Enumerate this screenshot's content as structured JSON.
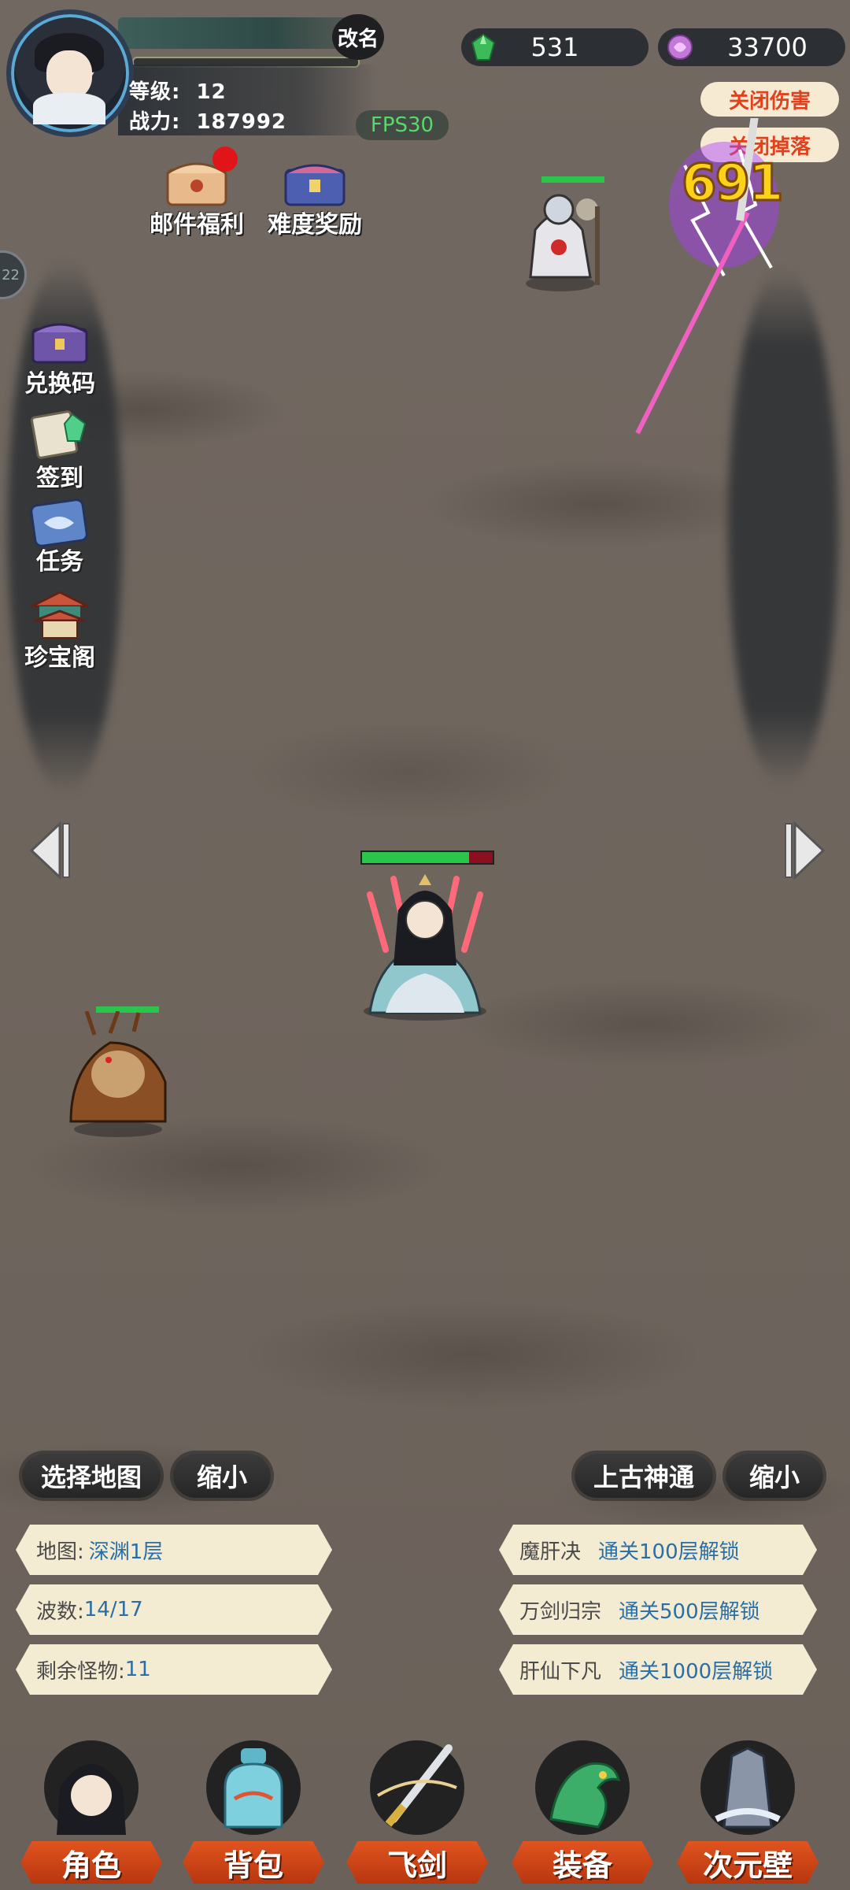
{
  "player": {
    "rename_label": "改名",
    "level_label": "等级:",
    "level": "12",
    "power_label": "战力:",
    "power": "187992",
    "fps": "FPS30"
  },
  "currency": {
    "gems": "531",
    "spirit": "33700",
    "gem_color": "#3dbb5a",
    "spirit_color": "#c27ad6"
  },
  "toggles": {
    "damage": "关闭伤害",
    "drops": "关闭掉落"
  },
  "top_icons": [
    {
      "label": "邮件福利",
      "icon": "mail-chest-icon",
      "badge": true
    },
    {
      "label": "难度奖励",
      "icon": "difficulty-chest-icon",
      "badge": false
    }
  ],
  "side_icons": [
    {
      "label": "兑换码",
      "icon": "redeem-chest-icon"
    },
    {
      "label": "签到",
      "icon": "signin-scroll-icon"
    },
    {
      "label": "任务",
      "icon": "quest-scroll-icon"
    },
    {
      "label": "珍宝阁",
      "icon": "treasure-pavilion-icon"
    }
  ],
  "edge_tab": "22",
  "battle": {
    "damage_number": "691",
    "player_hp_fraction": 0.82,
    "boss_hp_fraction": 1.0,
    "beast_hp_fraction": 1.0
  },
  "left_buttons": {
    "select_map": "选择地图",
    "shrink": "缩小"
  },
  "right_buttons": {
    "ancient_skill": "上古神通",
    "shrink": "缩小"
  },
  "left_info": [
    {
      "label": "地图:",
      "value": "深渊1层"
    },
    {
      "label": "波数:",
      "value": "14/17"
    },
    {
      "label": "剩余怪物:",
      "value": "11"
    }
  ],
  "right_info": [
    {
      "label": "魔肝决",
      "value": "通关100层解锁"
    },
    {
      "label": "万剑归宗",
      "value": "通关500层解锁"
    },
    {
      "label": "肝仙下凡",
      "value": "通关1000层解锁"
    }
  ],
  "nav": [
    {
      "label": "角色",
      "icon": "character-icon"
    },
    {
      "label": "背包",
      "icon": "backpack-icon"
    },
    {
      "label": "飞剑",
      "icon": "flying-sword-icon"
    },
    {
      "label": "装备",
      "icon": "equipment-icon"
    },
    {
      "label": "次元壁",
      "icon": "dimension-wall-icon"
    }
  ],
  "colors": {
    "accent_red": "#e0421f",
    "hp_green": "#2ac54a",
    "info_value_blue": "#2a6ea8"
  }
}
